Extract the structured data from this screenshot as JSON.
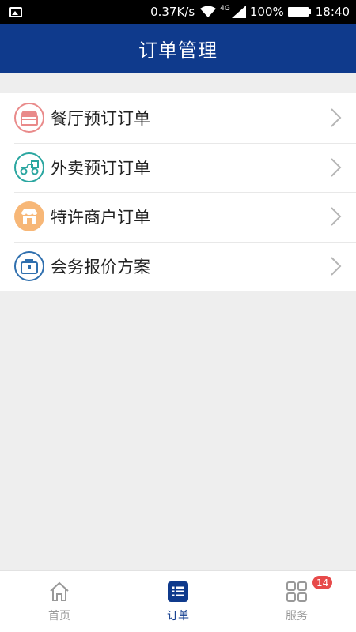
{
  "status_bar": {
    "net_speed": "0.37K/s",
    "network_type": "4G",
    "battery": "100%",
    "time": "18:40"
  },
  "header": {
    "title": "订单管理"
  },
  "menu": {
    "items": [
      {
        "label": "餐厅预订订单",
        "icon": "restaurant-icon",
        "color": "#e98a8a"
      },
      {
        "label": "外卖预订订单",
        "icon": "delivery-scooter-icon",
        "color": "#2aa6a0"
      },
      {
        "label": "特许商户订单",
        "icon": "merchant-shop-icon",
        "color": "#f7b777"
      },
      {
        "label": "会务报价方案",
        "icon": "briefcase-icon",
        "color": "#2f6fae"
      }
    ]
  },
  "tabbar": {
    "tabs": [
      {
        "label": "首页",
        "icon": "home-icon"
      },
      {
        "label": "订单",
        "icon": "order-list-icon"
      },
      {
        "label": "服务",
        "icon": "grid-services-icon",
        "badge": "14"
      }
    ],
    "active_color": "#0f3a8c",
    "badge_color": "#e74a4a"
  }
}
